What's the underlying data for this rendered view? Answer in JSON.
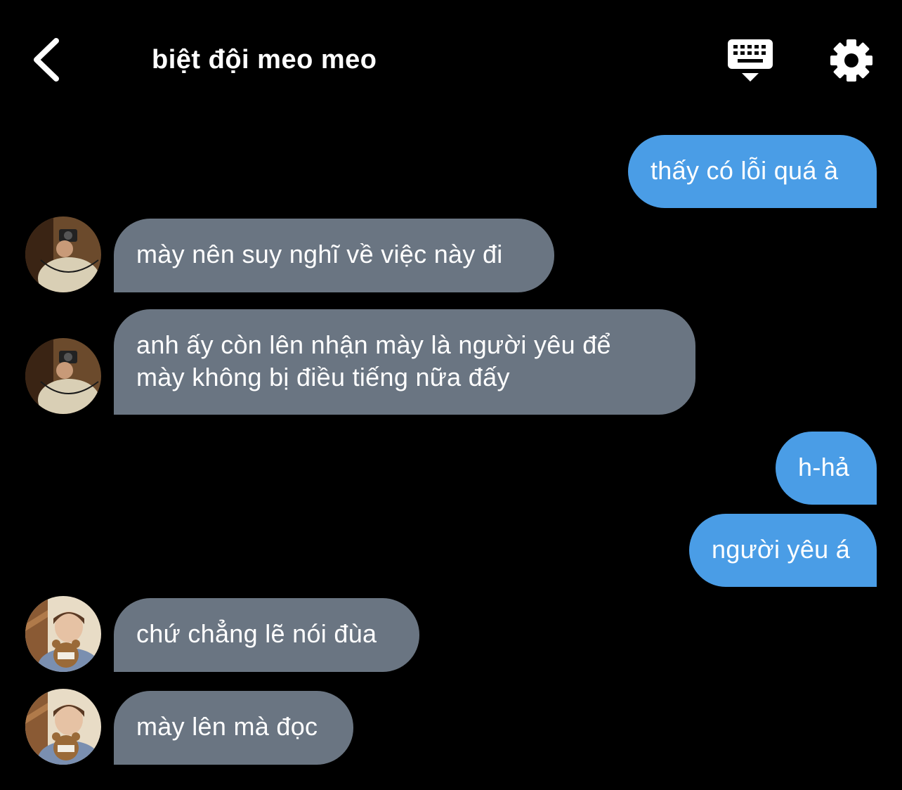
{
  "header": {
    "title": "biệt đội meo meo",
    "back_icon": "chevron-left-icon",
    "keyboard_icon": "keyboard-icon",
    "settings_icon": "gear-icon"
  },
  "colors": {
    "background": "#000000",
    "outgoing_bubble": "#4a9de6",
    "incoming_bubble": "#6a7582",
    "text": "#ffffff"
  },
  "messages": [
    {
      "direction": "out",
      "text": "thấy có lỗi quá à"
    },
    {
      "direction": "in",
      "avatar": "avatar-mirror-selfie",
      "text": "mày nên suy nghĩ về việc này đi"
    },
    {
      "direction": "in",
      "avatar": "avatar-mirror-selfie",
      "text": "anh ấy còn lên nhận mày là người yêu để\nmày không bị điều tiếng nữa đấy"
    },
    {
      "direction": "out",
      "text": "h-hả"
    },
    {
      "direction": "out",
      "text": "người yêu á"
    },
    {
      "direction": "in",
      "avatar": "avatar-teddy-bear",
      "text": "chứ chẳng lẽ nói đùa"
    },
    {
      "direction": "in",
      "avatar": "avatar-teddy-bear",
      "text": "mày lên mà đọc"
    }
  ]
}
